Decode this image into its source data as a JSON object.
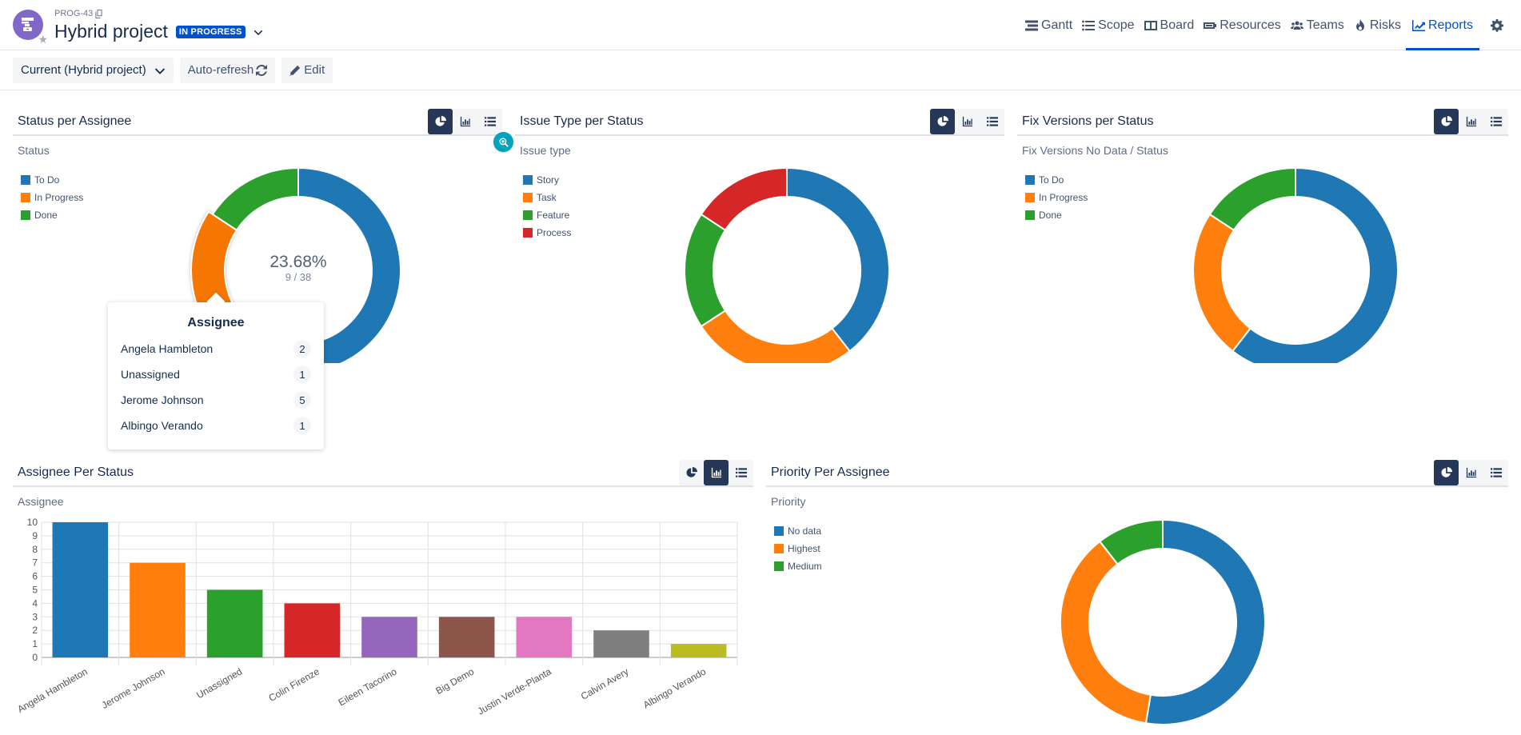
{
  "header": {
    "project_key": "PROG-43",
    "project_title": "Hybrid project",
    "status_badge": "IN PROGRESS",
    "avatar_icon": "project-robot-icon",
    "nav": [
      {
        "label": "Gantt",
        "icon": "gantt-icon",
        "active": false
      },
      {
        "label": "Scope",
        "icon": "list-icon",
        "active": false
      },
      {
        "label": "Board",
        "icon": "board-icon",
        "active": false
      },
      {
        "label": "Resources",
        "icon": "resources-icon",
        "active": false
      },
      {
        "label": "Teams",
        "icon": "teams-icon",
        "active": false
      },
      {
        "label": "Risks",
        "icon": "fire-icon",
        "active": false
      },
      {
        "label": "Reports",
        "icon": "chart-line-icon",
        "active": true
      }
    ],
    "settings_icon": "gear-icon"
  },
  "toolbar": {
    "scope_select": "Current (Hybrid project)",
    "auto_refresh": "Auto-refresh",
    "edit": "Edit"
  },
  "colors": {
    "accent": "#0052cc",
    "blue": "#1f77b4",
    "orange": "#ff7f0e",
    "green": "#2ca02c",
    "red": "#d62728",
    "purple": "#9467bd",
    "brown": "#8c564b",
    "pink": "#e377c2",
    "gray": "#7f7f7f",
    "olive": "#bcbd22"
  },
  "panels": {
    "status_per_assignee": {
      "title": "Status per Assignee",
      "subtitle": "Status",
      "active_view": "pie",
      "center_percent": "23.68%",
      "center_fraction": "9 / 38",
      "tooltip": {
        "title": "Assignee",
        "rows": [
          {
            "name": "Angela Hambleton",
            "count": "2"
          },
          {
            "name": "Unassigned",
            "count": "1"
          },
          {
            "name": "Jerome Johnson",
            "count": "5"
          },
          {
            "name": "Albingo Verando",
            "count": "1"
          }
        ]
      }
    },
    "issue_type_per_status": {
      "title": "Issue Type per Status",
      "subtitle": "Issue type",
      "active_view": "pie"
    },
    "fix_versions_per_status": {
      "title": "Fix Versions per Status",
      "subtitle": "Fix Versions  No Data / Status",
      "active_view": "pie"
    },
    "assignee_per_status": {
      "title": "Assignee Per Status",
      "subtitle": "Assignee",
      "active_view": "bar"
    },
    "priority_per_assignee": {
      "title": "Priority Per Assignee",
      "subtitle": "Priority",
      "active_view": "pie"
    }
  },
  "chart_data": [
    {
      "id": "status",
      "type": "pie",
      "title": "Status per Assignee",
      "categories": [
        "To Do",
        "In Progress",
        "Done"
      ],
      "values": [
        23,
        9,
        6
      ],
      "colors": [
        "#1f77b4",
        "#ff7f0e",
        "#2ca02c"
      ],
      "highlighted": "In Progress",
      "legend": "top-left"
    },
    {
      "id": "issuetype",
      "type": "pie",
      "title": "Issue Type per Status",
      "categories": [
        "Story",
        "Task",
        "Feature",
        "Process"
      ],
      "values": [
        15,
        10,
        7,
        6
      ],
      "colors": [
        "#1f77b4",
        "#ff7f0e",
        "#2ca02c",
        "#d62728"
      ],
      "legend": "top-left"
    },
    {
      "id": "fixversions",
      "type": "pie",
      "title": "Fix Versions per Status",
      "categories": [
        "To Do",
        "In Progress",
        "Done"
      ],
      "values": [
        23,
        9,
        6
      ],
      "colors": [
        "#1f77b4",
        "#ff7f0e",
        "#2ca02c"
      ],
      "legend": "top-left"
    },
    {
      "id": "assignee",
      "type": "bar",
      "title": "Assignee Per Status",
      "ylabel": "Assignee",
      "categories": [
        "Angela Hambleton",
        "Jerome Johnson",
        "Unassigned",
        "Colin Firenze",
        "Eileen Tacorino",
        "Big Demo",
        "Justin Verde-Planta",
        "Calvin Avery",
        "Albingo Verando"
      ],
      "values": [
        10,
        7,
        5,
        4,
        3,
        3,
        3,
        2,
        1
      ],
      "colors": [
        "#1f77b4",
        "#ff7f0e",
        "#2ca02c",
        "#d62728",
        "#9467bd",
        "#8c564b",
        "#e377c2",
        "#7f7f7f",
        "#bcbd22"
      ],
      "ylim": [
        0,
        10
      ],
      "yticks": [
        0,
        1,
        2,
        3,
        4,
        5,
        6,
        7,
        8,
        9,
        10
      ],
      "grid": true
    },
    {
      "id": "priority",
      "type": "pie",
      "title": "Priority Per Assignee",
      "categories": [
        "No data",
        "Highest",
        "Medium"
      ],
      "values": [
        20,
        14,
        4
      ],
      "colors": [
        "#1f77b4",
        "#ff7f0e",
        "#2ca02c"
      ],
      "legend": "top-left"
    }
  ]
}
